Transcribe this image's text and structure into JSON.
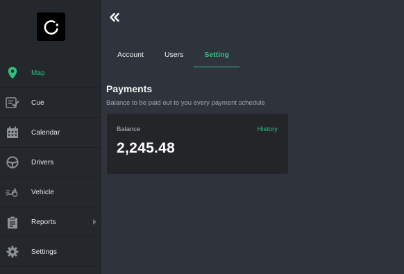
{
  "sidebar": {
    "items": [
      {
        "label": "Map",
        "icon": "map-pin-icon",
        "active": true
      },
      {
        "label": "Cue",
        "icon": "checklist-icon",
        "active": false
      },
      {
        "label": "Calendar",
        "icon": "calendar-icon",
        "active": false
      },
      {
        "label": "Drivers",
        "icon": "steering-wheel-icon",
        "active": false
      },
      {
        "label": "Vehicle",
        "icon": "motorcycle-icon",
        "active": false
      },
      {
        "label": "Reports",
        "icon": "clipboard-icon",
        "active": false,
        "has_submenu": true
      },
      {
        "label": "Settings",
        "icon": "gear-icon",
        "active": false
      }
    ]
  },
  "header": {
    "collapse_icon": "double-chevron-left-icon"
  },
  "tabs": [
    {
      "label": "Account",
      "active": false
    },
    {
      "label": "Users",
      "active": false
    },
    {
      "label": "Setting",
      "active": true
    }
  ],
  "payments": {
    "title": "Payments",
    "subtitle": "Balance to be paid out to you every payment schedule",
    "balance_label": "Balance",
    "history_label": "History",
    "balance_value": "2,245.48"
  },
  "colors": {
    "accent": "#2ec27e",
    "sidebar_bg": "#24272c",
    "main_bg": "#2f333b",
    "card_bg": "#232529"
  }
}
